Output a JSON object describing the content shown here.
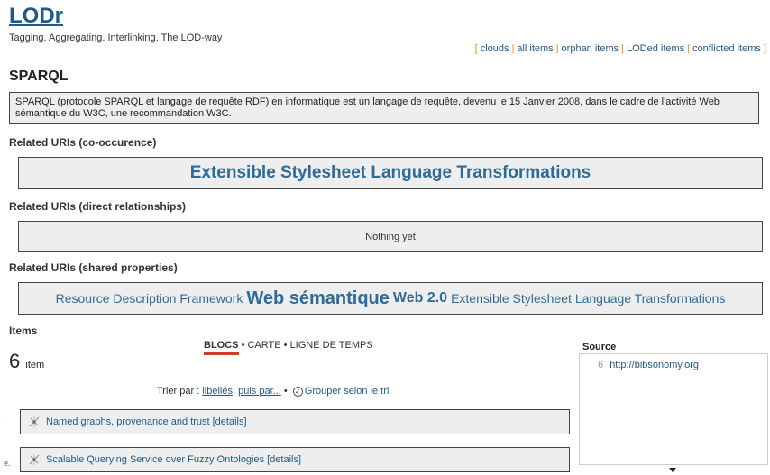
{
  "brand": {
    "name": "LODr",
    "tagline": "Tagging. Aggregating. Interlinking. The LOD-way"
  },
  "topnav": {
    "open": "[",
    "close": "]",
    "links": [
      "clouds",
      "all items",
      "orphan items",
      "LODed items",
      "conflicted items"
    ]
  },
  "page": {
    "title": "SPARQL",
    "description": "SPARQL (protocole SPARQL et langage de requête RDF) en informatique est un langage de requête, devenu le 15 Janvier 2008, dans le cadre de l'activité Web sémantique du W3C, une recommandation W3C."
  },
  "related": {
    "cooccurrence_heading": "Related URIs (co-occurence)",
    "cooccurrence": [
      "Extensible Stylesheet Language Transformations"
    ],
    "direct_heading": "Related URIs (direct relationships)",
    "direct_empty": "Nothing yet",
    "shared_heading": "Related URIs (shared properties)",
    "shared": [
      "Resource Description Framework",
      "Web sémantique",
      "Web 2.0",
      "Extensible Stylesheet Language Transformations"
    ]
  },
  "items": {
    "heading": "Items",
    "views": {
      "active": "BLOCS",
      "sep": "•",
      "others": [
        "CARTE",
        "LIGNE DE TEMPS"
      ]
    },
    "count": "6",
    "count_unit": "item",
    "sort": {
      "label": "Trier par :",
      "by_label": "libellés",
      "then": "puis par...",
      "sep": "•",
      "group": "Grouper selon le tri"
    },
    "list": [
      {
        "title": "Named graphs, provenance and trust",
        "details": "[details]",
        "marker": "."
      },
      {
        "title": "Scalable Querying Service over Fuzzy Ontologies",
        "details": "[details]",
        "marker": "e."
      }
    ]
  },
  "source": {
    "label": "Source",
    "rows": [
      {
        "count": "6",
        "url": "http://bibsonomy.org"
      }
    ]
  },
  "icons": {
    "item": "tag-network-icon",
    "check": "check-circle-icon",
    "dropdown": "caret-down-icon"
  }
}
